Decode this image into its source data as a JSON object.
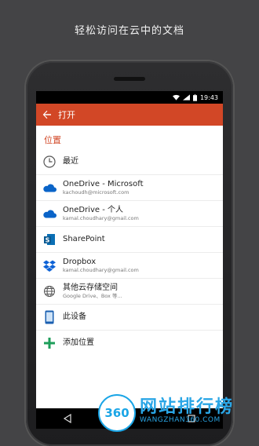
{
  "caption": "轻松访问在云中的文档",
  "status": {
    "time": "19:43"
  },
  "appbar": {
    "title": "打开"
  },
  "section": {
    "title": "位置"
  },
  "items": [
    {
      "title": "最近",
      "subtitle": ""
    },
    {
      "title": "OneDrive - Microsoft",
      "subtitle": "kachoudh@microsoft.com"
    },
    {
      "title": "OneDrive - 个人",
      "subtitle": "kamal.choudhary@gmail.com"
    },
    {
      "title": "SharePoint",
      "subtitle": ""
    },
    {
      "title": "Dropbox",
      "subtitle": "kamal.choudhary@gmail.com"
    },
    {
      "title": "其他云存储空间",
      "subtitle": "Google Drive、Box 等..."
    },
    {
      "title": "此设备",
      "subtitle": ""
    },
    {
      "title": "添加位置",
      "subtitle": ""
    }
  ],
  "watermark": {
    "logo": "360",
    "text": "网站排行榜",
    "url": "WANGZHAN360.COM"
  },
  "colors": {
    "accent": "#d24726",
    "onedrive": "#0a64c8",
    "sharepoint": "#0a6fb5",
    "dropbox": "#0d62d6",
    "add": "#1e9e5a"
  }
}
